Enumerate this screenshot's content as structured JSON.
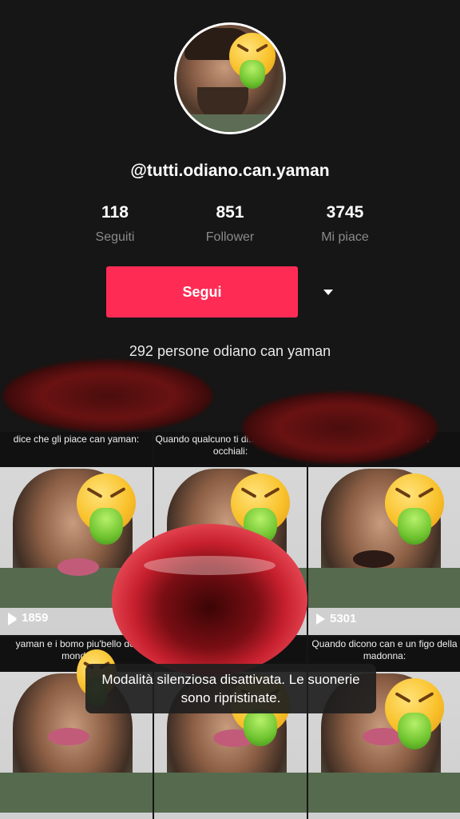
{
  "profile": {
    "username": "@tutti.odiano.can.yaman",
    "bio": "292 persone odiano can yaman"
  },
  "stats": [
    {
      "value": "118",
      "label": "Seguiti"
    },
    {
      "value": "851",
      "label": "Follower"
    },
    {
      "value": "3745",
      "label": "Mi piace"
    }
  ],
  "actions": {
    "follow_label": "Segui",
    "more_icon": "caret-down-icon"
  },
  "colors": {
    "accent": "#fe2c55",
    "background": "#161616"
  },
  "videos": [
    {
      "caption": "dice che gli piace can yaman:",
      "plays": ""
    },
    {
      "caption": "Quando qualcuno ti di... ti presto gli occhiali:",
      "plays": ""
    },
    {
      "caption": "con",
      "plays": ""
    },
    {
      "caption": "",
      "plays": "1859"
    },
    {
      "caption": "",
      "plays": ""
    },
    {
      "caption": "",
      "plays": "5301"
    },
    {
      "caption": "yaman e i bomo piu'bello del mondo",
      "plays": ""
    },
    {
      "caption": "",
      "plays": ""
    },
    {
      "caption": "Quando dicono can e un figo della madonna:",
      "plays": ""
    }
  ],
  "toast": {
    "text": "Modalità silenziosa disattivata. Le suonerie sono ripristinate."
  }
}
